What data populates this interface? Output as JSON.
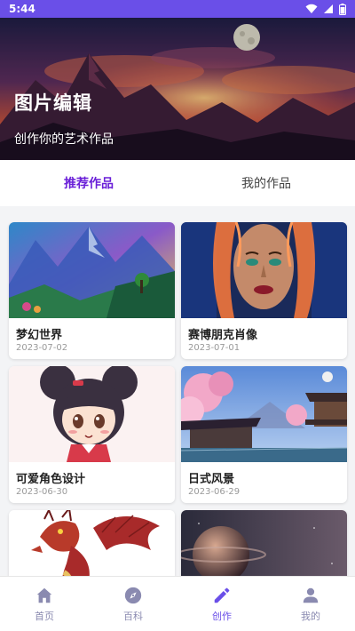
{
  "status_bar": {
    "time": "5:44",
    "icons": [
      "wifi-icon",
      "signal-icon",
      "battery-icon"
    ]
  },
  "hero": {
    "title": "图片编辑",
    "subtitle": "创作你的艺术作品"
  },
  "tabs": [
    {
      "label": "推荐作品",
      "active": true
    },
    {
      "label": "我的作品",
      "active": false
    }
  ],
  "cards": [
    {
      "title": "梦幻世界",
      "date": "2023-07-02"
    },
    {
      "title": "赛博朋克肖像",
      "date": "2023-07-01"
    },
    {
      "title": "可爱角色设计",
      "date": "2023-06-30"
    },
    {
      "title": "日式风景",
      "date": "2023-06-29"
    },
    {
      "title": "",
      "date": ""
    },
    {
      "title": "",
      "date": ""
    }
  ],
  "bottom_nav": [
    {
      "label": "首页",
      "icon": "home-icon",
      "active": false
    },
    {
      "label": "百科",
      "icon": "compass-icon",
      "active": false
    },
    {
      "label": "创作",
      "icon": "pencil-icon",
      "active": true
    },
    {
      "label": "我的",
      "icon": "user-icon",
      "active": false
    }
  ],
  "colors": {
    "accent": "#6a4fe8",
    "active_tab": "#6a1fd8",
    "nav_inactive": "#8a8ab0"
  }
}
